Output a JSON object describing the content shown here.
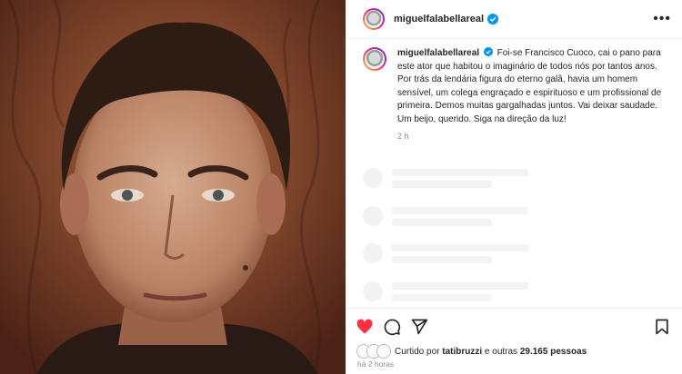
{
  "post": {
    "username": "miguelfalabellareal",
    "caption_username": "miguelfalabellareal",
    "caption_text": "Foi-se Francisco Cuoco, cai o pano para este ator que habitou o imaginário de todos nós por tantos anos. Por trás da lendária figura do eterno galã, havia um homem sensível, um colega engraçado e espirituoso e um profissional de primeira. Demos muitas gargalhadas juntos. Vai deixar saudade. Um beijo, querido. Siga na direção da luz!",
    "caption_time": "2 h",
    "liked_prefix": "Curtido por ",
    "liked_user": "tatibruzzi",
    "liked_suffix": " e outras ",
    "liked_count": "29.165 pessoas",
    "posted_ago": "há 2 horas",
    "liked": true
  },
  "icons": {
    "more": "more-horizontal-icon",
    "verified": "verified-badge-icon",
    "like": "heart-icon",
    "comment": "comment-icon",
    "share": "send-icon",
    "save": "bookmark-icon"
  },
  "colors": {
    "like_red": "#ff3040",
    "verified_blue": "#0095f6",
    "muted_text": "#8e8e8e"
  }
}
